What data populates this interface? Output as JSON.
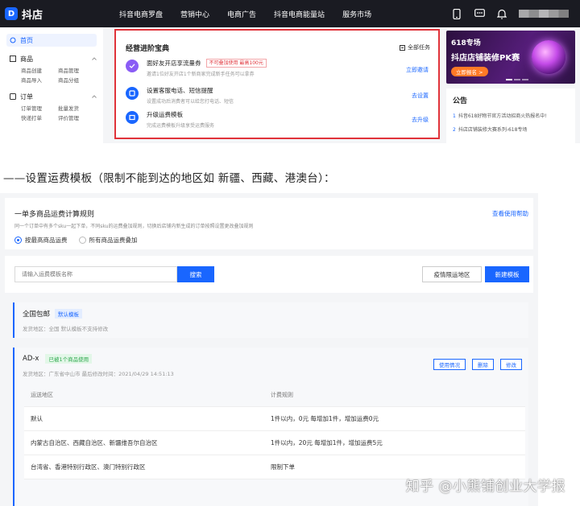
{
  "top": {
    "app_name": "抖店",
    "nav": [
      "抖音电商罗盘",
      "营销中心",
      "电商广告",
      "抖音电商能量站",
      "服务市场"
    ],
    "sidebar": {
      "home": "首页",
      "groups": [
        {
          "title": "商品",
          "subs": [
            "商品创建",
            "商品管理",
            "商品导入",
            "商品分组"
          ]
        },
        {
          "title": "订单",
          "subs": [
            "订单管理",
            "批量发货",
            "快递打单",
            "评价管理"
          ]
        }
      ]
    },
    "panel": {
      "title": "经营进阶宝典",
      "all_tasks": "全部任务",
      "tasks": [
        {
          "title": "面好友开店享流量券",
          "badge": "不可叠加使用 最高100元",
          "desc": "邀请1位好友开店1个新商家完成新手任务可以拿券",
          "action": "立即邀请"
        },
        {
          "title": "设置客服电话、短信提醒",
          "badge": "",
          "desc": "设置成功后消费者可以给您打电话、短信",
          "action": "去设置"
        },
        {
          "title": "升级运费模板",
          "badge": "",
          "desc": "完成运费模板升级享受运费服务",
          "action": "去升级"
        }
      ]
    },
    "promo": {
      "line1": "618专场",
      "line2": "抖店店铺装修PK赛",
      "cta": "立即报名 >"
    },
    "notice": {
      "title": "公告",
      "items": [
        "抖音618好物节官方活动招商火热报名中!",
        "抖店店铺装修大赛系列-618专场"
      ]
    }
  },
  "caption": "——设置运费模板（限制不能到达的地区如 新疆、西藏、港澳台）：",
  "bottom": {
    "rule_title": "一单多商品运费计算规则",
    "help_link": "查看使用帮助",
    "rule_desc": "同一个订单中有多个sku一起下单，不同sku的运费叠加规则，切换后店铺内新生成的订单按照设置更改叠加规则",
    "radio_options": [
      "按最高商品运费",
      "所有商品运费叠加"
    ],
    "search_placeholder": "请输入运费模板名称",
    "search_btn": "搜索",
    "restrict_btn": "疫情限运地区",
    "new_btn": "新建模板",
    "tpl1": {
      "name": "全国包邮",
      "tag": "默认模板",
      "sub": "发货地区：全国     默认模板不支持修改"
    },
    "tpl2": {
      "name": "AD-x",
      "tag": "已被1个商品使用",
      "sub": "发货地区：广东省中山市      最后修改时间：2021/04/29 14:51:13",
      "actions": [
        "使用情况",
        "删除",
        "修改"
      ],
      "table_head": [
        "运送地区",
        "计费规则"
      ],
      "rows": [
        [
          "默认",
          "1件以内，0元    每增加1件，增加运费0元"
        ],
        [
          "内蒙古自治区、西藏自治区、新疆维吾尔自治区",
          "1件以内，20元    每增加1件，增加运费5元"
        ],
        [
          "台湾省、香港特别行政区、澳门特别行政区",
          "限制下单"
        ]
      ]
    },
    "watermark": "知乎 @小熊铺创业大学报"
  }
}
